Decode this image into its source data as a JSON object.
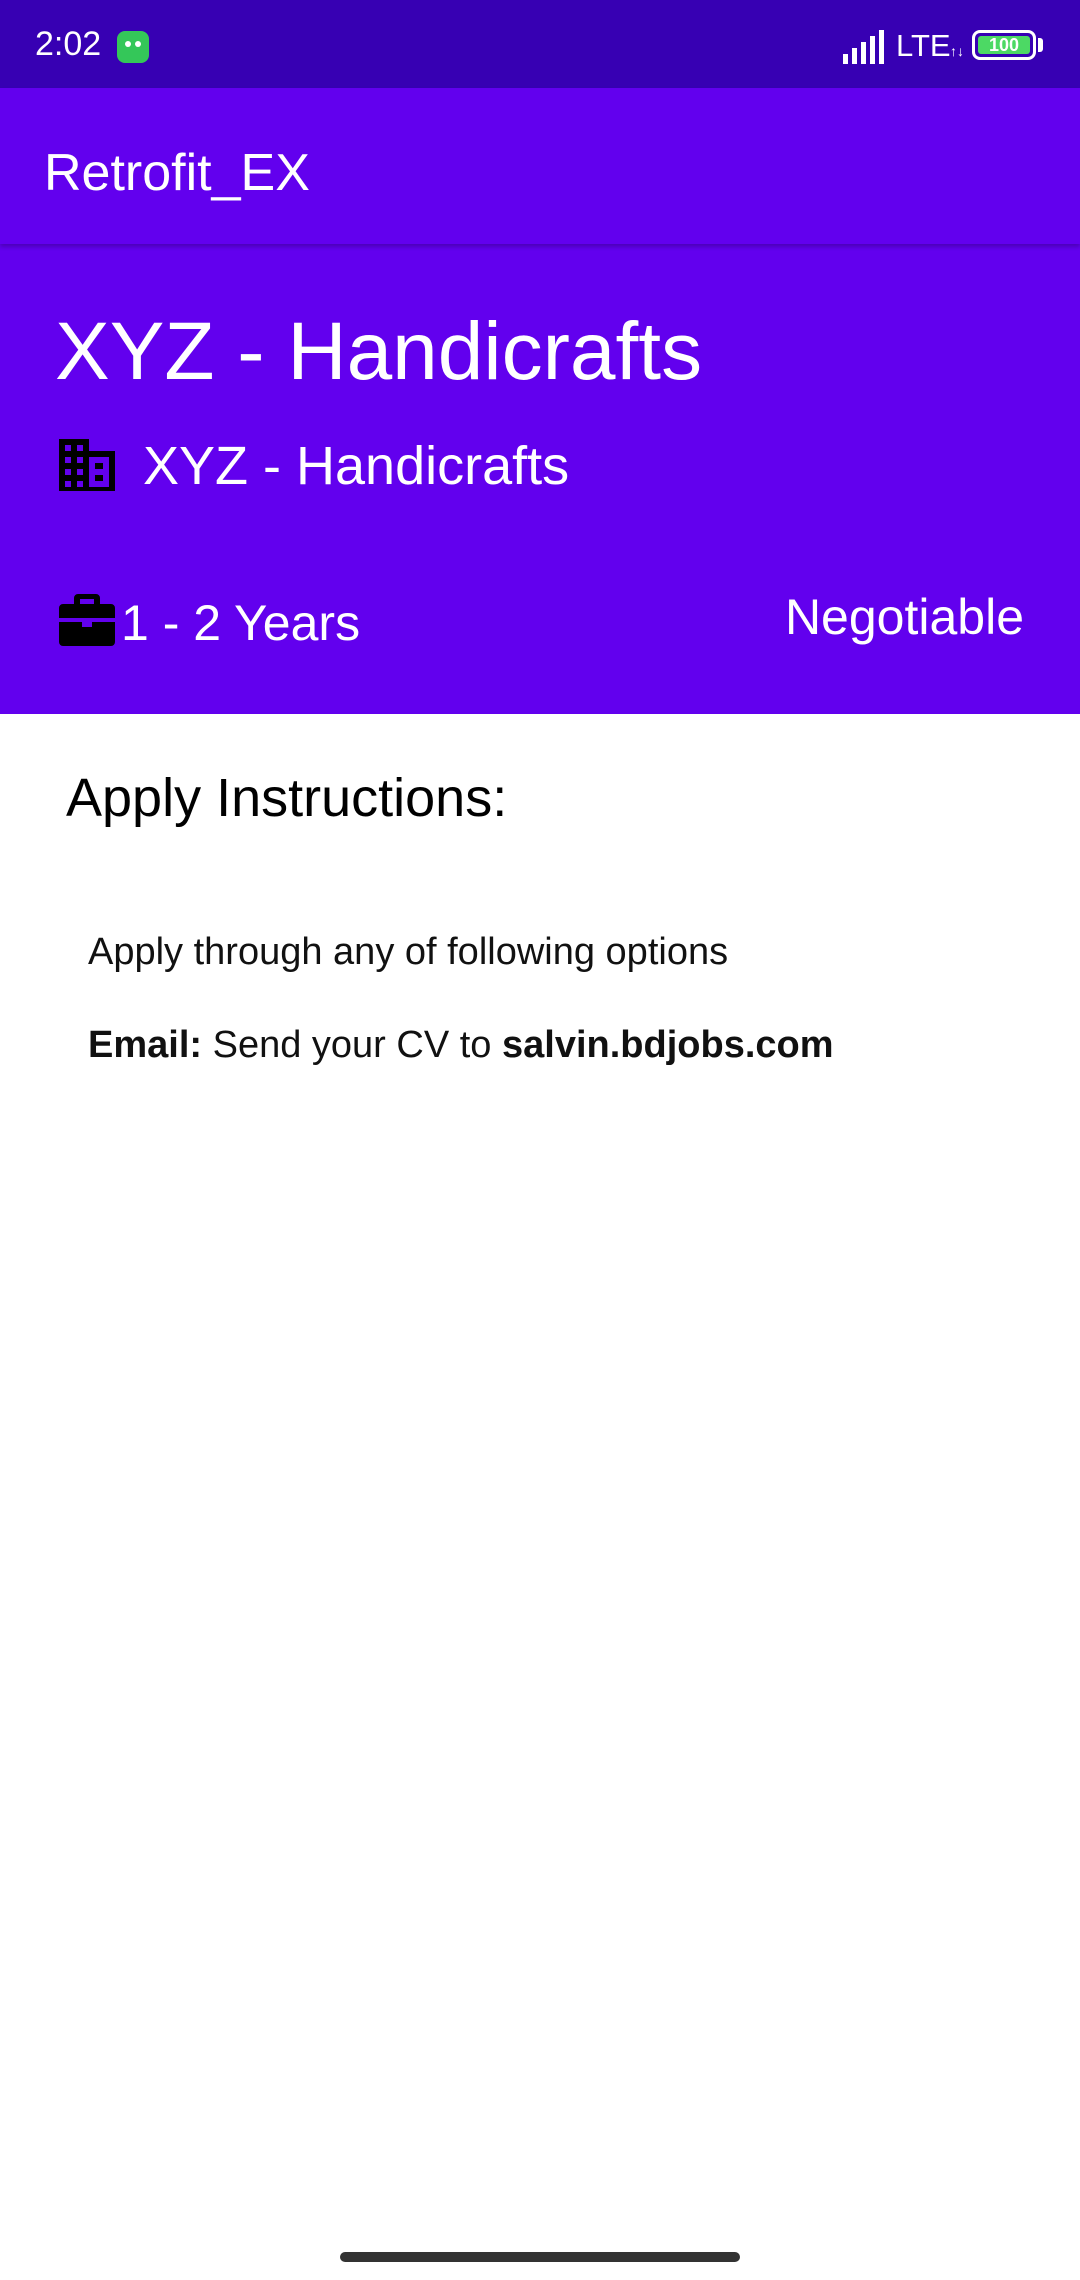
{
  "status_bar": {
    "time": "2:02",
    "network": "LTE",
    "battery": "100",
    "app_icon": "android-robot-icon"
  },
  "app_bar": {
    "title": "Retrofit_EX"
  },
  "job": {
    "title": "XYZ - Handicrafts",
    "company": "XYZ - Handicrafts",
    "company_icon": "building-icon",
    "experience": "1 - 2 Years",
    "experience_icon": "briefcase-icon",
    "salary": "Negotiable"
  },
  "apply": {
    "heading": "Apply Instructions:",
    "line1": "Apply through any of following options",
    "email_label": "Email:",
    "email_text": "Send your CV to",
    "email_address": "salvin.bdjobs.com"
  },
  "colors": {
    "status_bar": "#3700b3",
    "primary": "#6200ee",
    "background": "#ffffff"
  }
}
